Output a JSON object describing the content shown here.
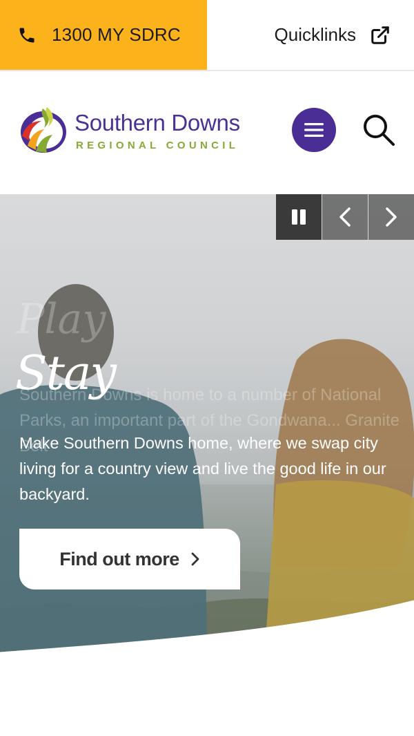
{
  "utility_bar": {
    "phone_label": "1300 MY SDRC",
    "quicklinks_label": "Quicklinks",
    "accent_color": "#fbb21b"
  },
  "header": {
    "logo_title": "Southern Downs",
    "logo_subtitle": "REGIONAL COUNCIL",
    "brand_color": "#4b2e95",
    "brand_green": "#86a934",
    "menu_icon": "hamburger-icon",
    "search_icon": "search-icon"
  },
  "hero": {
    "script_heading": "Stay",
    "ghost_heading": "Play",
    "ghost_text": "Southern Downs is home to a number of National Parks, an important part of the Gondwana... Granite Belt",
    "description": "Make Southern Downs home, where we swap city living for a country view and live the good life in our backyard.",
    "cta_label": "Find out more",
    "controls": {
      "pause_icon": "pause-icon",
      "prev_icon": "chevron-left-icon",
      "next_icon": "chevron-right-icon"
    }
  }
}
